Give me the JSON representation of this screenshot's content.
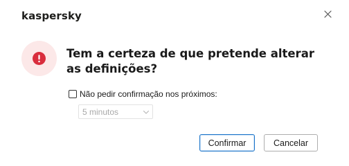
{
  "app": {
    "logo_text": "kaspersky"
  },
  "dialog": {
    "question": "Tem a certeza de que pretende alterar as definições?",
    "alert_icon": "exclamation-circle-icon",
    "close_icon": "close-icon",
    "colors": {
      "alert_bg": "#fce8e8",
      "alert_fg": "#d92d3d",
      "primary_border": "#1a73c8"
    }
  },
  "options": {
    "dont_ask_label": "Não pedir confirmação nos próximos:",
    "dont_ask_checked": false,
    "duration_selected": "5 minutos",
    "duration_disabled": true
  },
  "buttons": {
    "confirm_label": "Confirmar",
    "cancel_label": "Cancelar"
  }
}
